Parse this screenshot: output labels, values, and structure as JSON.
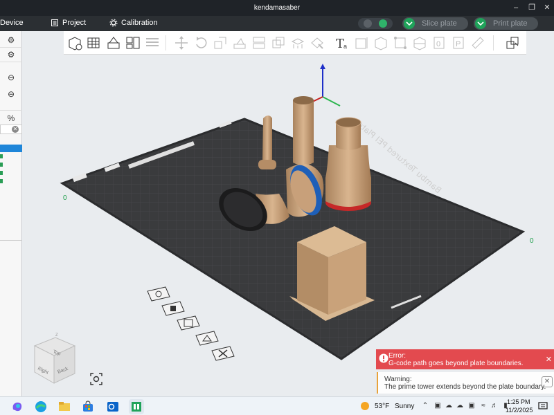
{
  "window": {
    "title": "kendamasaber"
  },
  "menu": {
    "device": "Device",
    "project": "Project",
    "calibration": "Calibration",
    "slice_button": "Slice plate",
    "print_button": "Print plate"
  },
  "plate": {
    "label": "Bambu Textured PEI Plate",
    "axis_origin_left": "0",
    "axis_origin_right": "0"
  },
  "nav_cube": {
    "top": "Top",
    "right": "Right",
    "back": "Back",
    "z": "Z"
  },
  "notifications": {
    "error_title": "Error:",
    "error_message": "G-code path goes beyond plate boundaries.",
    "warning_title": "Warning:",
    "warning_message": "The prime tower extends beyond the plate boundary."
  },
  "taskbar": {
    "weather_temp": "53°F",
    "weather_desc": "Sunny",
    "time": "1:25 PM",
    "date": "11/2/2025"
  },
  "colors": {
    "accent_green": "#1fa35a",
    "error_red": "#e34a4f",
    "warning_orange": "#e8a23a",
    "plate_dark": "#3a3b3d",
    "model_tan": "#c8a07a",
    "ring_blue": "#1e5fb8",
    "ring_red": "#c62828"
  }
}
